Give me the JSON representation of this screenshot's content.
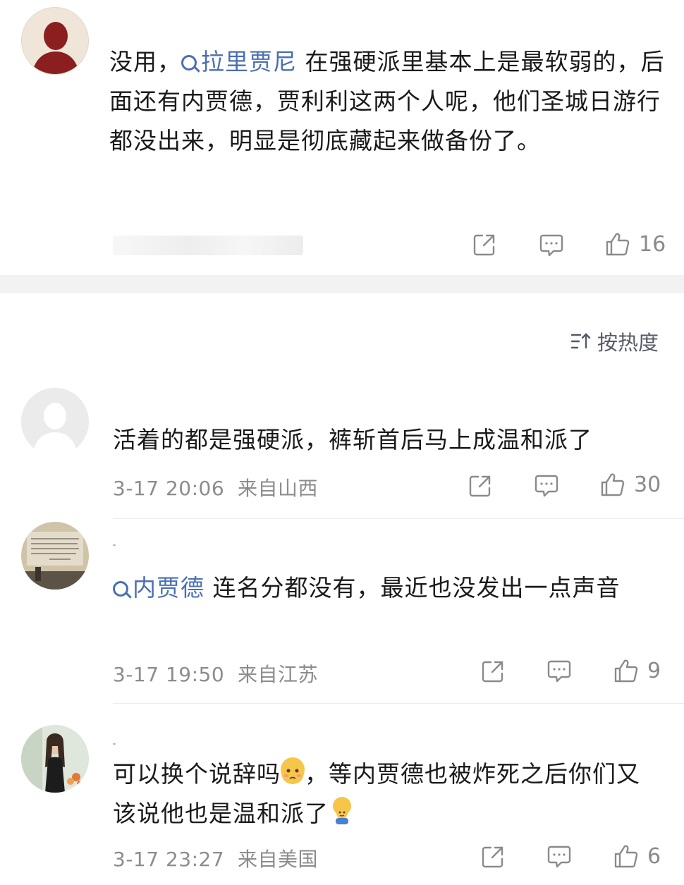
{
  "post": {
    "text_before": "没用，",
    "mention": "拉里贾尼",
    "text_after": " 在强硬派里基本上是最软弱的，后面还有内贾德，贾利利这两个人呢，他们圣城日游行都没出来，明显是彻底藏起来做备份了。",
    "like_count": "16"
  },
  "sort": {
    "label": "按热度"
  },
  "comments": [
    {
      "text": "活着的都是强硬派，裤斩首后马上成温和派了",
      "time": "3-17 20:06",
      "location": "来自山西",
      "like_count": "30"
    },
    {
      "mention": "内贾德",
      "text": " 连名分都没有，最近也没发出一点声音",
      "time": "3-17 19:50",
      "location": "来自江苏",
      "like_count": "9"
    },
    {
      "text_part1": "可以换个说辞吗",
      "text_part2": "，等内贾德也被炸死之后你们又该说他也是温和派了",
      "time": "3-17 23:27",
      "location": "来自美国",
      "like_count": "6"
    }
  ],
  "icons": [
    "share-icon",
    "comment-icon",
    "like-icon",
    "sort-icon",
    "search-mention-icon"
  ],
  "colors": {
    "mention": "#4a6fb5",
    "meta": "#8c8c8c",
    "divider": "#f2f2f2"
  }
}
